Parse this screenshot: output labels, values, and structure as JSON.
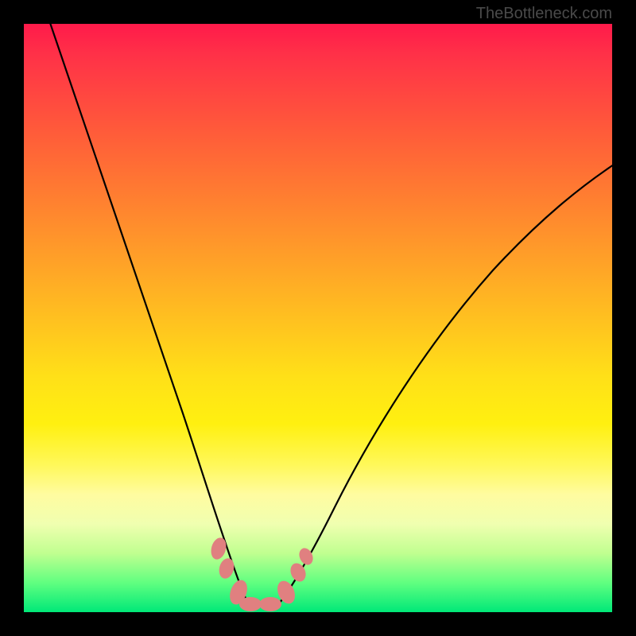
{
  "attribution": "TheBottleneck.com",
  "colors": {
    "frame": "#000000",
    "gradient_top": "#ff1a4a",
    "gradient_bottom": "#00e878",
    "curve": "#000000",
    "markers": "#e08080"
  },
  "chart_data": {
    "type": "line",
    "title": "",
    "xlabel": "",
    "ylabel": "",
    "xlim": [
      0,
      100
    ],
    "ylim": [
      0,
      100
    ],
    "grid": false,
    "series": [
      {
        "name": "left-curve",
        "x": [
          4,
          8,
          12,
          16,
          20,
          24,
          26,
          28,
          30,
          32,
          34,
          36,
          37.8
        ],
        "y": [
          100,
          84,
          70,
          57,
          45,
          33,
          28,
          23,
          18,
          13,
          8,
          4,
          1
        ]
      },
      {
        "name": "right-curve",
        "x": [
          43.2,
          46,
          50,
          55,
          60,
          65,
          70,
          75,
          80,
          85,
          90,
          95,
          100
        ],
        "y": [
          1,
          5,
          12,
          20,
          28,
          35,
          42,
          48,
          54,
          59,
          64,
          68,
          72
        ]
      }
    ],
    "annotations": [
      {
        "name": "marker-left-upper",
        "x": 33.1,
        "y": 10.8
      },
      {
        "name": "marker-left-mid",
        "x": 34.5,
        "y": 7.4
      },
      {
        "name": "marker-left-lower",
        "x": 36.5,
        "y": 3.4
      },
      {
        "name": "marker-valley-left",
        "x": 38.5,
        "y": 1.4
      },
      {
        "name": "marker-valley-right",
        "x": 41.9,
        "y": 1.4
      },
      {
        "name": "marker-right-lower",
        "x": 44.6,
        "y": 3.4
      },
      {
        "name": "marker-right-mid",
        "x": 46.6,
        "y": 6.8
      },
      {
        "name": "marker-right-upper",
        "x": 48.0,
        "y": 9.5
      }
    ],
    "description": "Bottleneck-style V curve over a red-to-green vertical gradient; minimum near x≈40 with salmon markers clustered at the valley."
  }
}
